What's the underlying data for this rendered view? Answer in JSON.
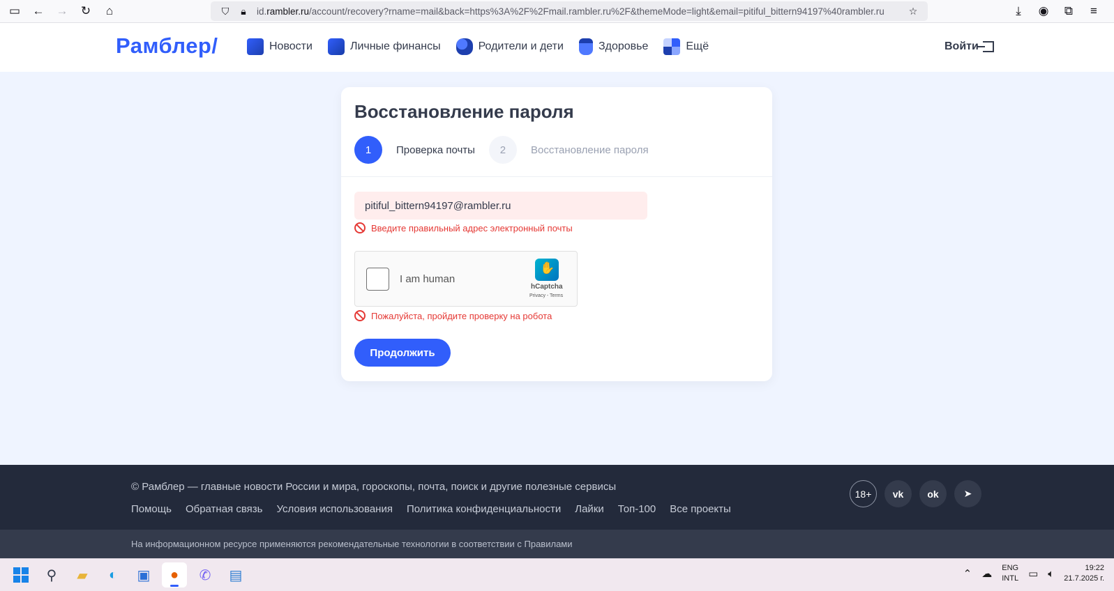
{
  "browser": {
    "url_prefix": "id.",
    "url_host": "rambler.ru",
    "url_path": "/account/recovery?rname=mail&back=https%3A%2F%2Fmail.rambler.ru%2F&themeMode=light&email=pitiful_bittern94197%40rambler.ru"
  },
  "header": {
    "logo": "Рамблер/",
    "nav": [
      {
        "label": "Новости",
        "icon": "newspaper-icon"
      },
      {
        "label": "Личные финансы",
        "icon": "wallet-icon"
      },
      {
        "label": "Родители и дети",
        "icon": "family-icon"
      },
      {
        "label": "Здоровье",
        "icon": "medicine-icon"
      },
      {
        "label": "Ещё",
        "icon": "grid-icon"
      }
    ],
    "login": "Войти"
  },
  "card": {
    "title": "Восстановление пароля",
    "steps": [
      {
        "num": "1",
        "label": "Проверка почты",
        "active": true
      },
      {
        "num": "2",
        "label": "Восстановление пароля",
        "active": false
      }
    ],
    "email_value": "pitiful_bittern94197@rambler.ru",
    "email_error": "Введите правильный адрес электронный почты",
    "captcha": {
      "label": "I am human",
      "brand": "hCaptcha",
      "links": "Privacy - Terms"
    },
    "captcha_error": "Пожалуйста, пройдите проверку на робота",
    "continue_label": "Продолжить"
  },
  "footer": {
    "copyright": "© Рамблер — главные новости России и мира, гороскопы, почта, поиск и другие полезные сервисы",
    "links": [
      "Помощь",
      "Обратная связь",
      "Условия использования",
      "Политика конфиденциальности",
      "Лайки",
      "Топ-100",
      "Все проекты"
    ],
    "age": "18+",
    "note": "На информационном ресурсе применяются рекомендательные технологии в соответствии с Правилами"
  },
  "taskbar": {
    "lang_top": "ENG",
    "lang_bottom": "INTL",
    "time": "19:22",
    "date": "21.7.2025 г."
  },
  "colors": {
    "accent": "#315efb",
    "error": "#e53935",
    "footer_bg": "#232a3b",
    "page_bg": "#eff4ff"
  }
}
